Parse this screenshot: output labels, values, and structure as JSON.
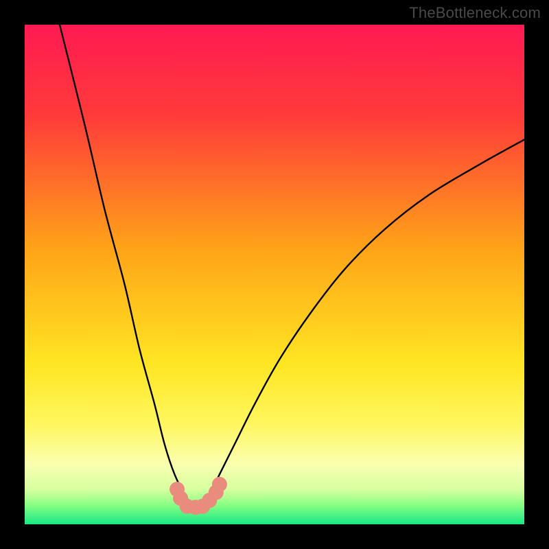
{
  "watermark": "TheBottleneck.com",
  "chart_data": {
    "type": "line",
    "title": "",
    "xlabel": "",
    "ylabel": "",
    "xlim": [
      0,
      100
    ],
    "ylim": [
      0,
      100
    ],
    "legend": false,
    "gradient_stops": [
      {
        "offset": 0.0,
        "color": "#ff1a52"
      },
      {
        "offset": 0.18,
        "color": "#ff3a3a"
      },
      {
        "offset": 0.45,
        "color": "#ffa418"
      },
      {
        "offset": 0.68,
        "color": "#ffe623"
      },
      {
        "offset": 0.8,
        "color": "#fff760"
      },
      {
        "offset": 0.88,
        "color": "#faffb0"
      },
      {
        "offset": 0.93,
        "color": "#d7ffa0"
      },
      {
        "offset": 0.96,
        "color": "#8cff84"
      },
      {
        "offset": 1.0,
        "color": "#17e884"
      }
    ],
    "series": [
      {
        "name": "bottleneck-curve",
        "color": "#000000",
        "x": [
          7,
          12,
          16,
          20,
          23,
          26,
          28,
          30,
          32,
          33.5,
          35,
          37,
          39,
          42,
          46,
          51,
          57,
          64,
          72,
          81,
          91,
          100
        ],
        "y": [
          100,
          80,
          63,
          48,
          35,
          24,
          16,
          10,
          6,
          4,
          4,
          6,
          10,
          16,
          24,
          33,
          42,
          51,
          59,
          66,
          72,
          77
        ]
      }
    ],
    "markers": {
      "name": "highlight-cluster",
      "color": "#e98b7d",
      "x": [
        30.5,
        31.2,
        32.5,
        34.2,
        35.6,
        37.0,
        38.3,
        39.0
      ],
      "y": [
        7.0,
        5.2,
        3.6,
        3.4,
        3.6,
        4.8,
        6.4,
        8.0
      ],
      "size": 11
    }
  }
}
